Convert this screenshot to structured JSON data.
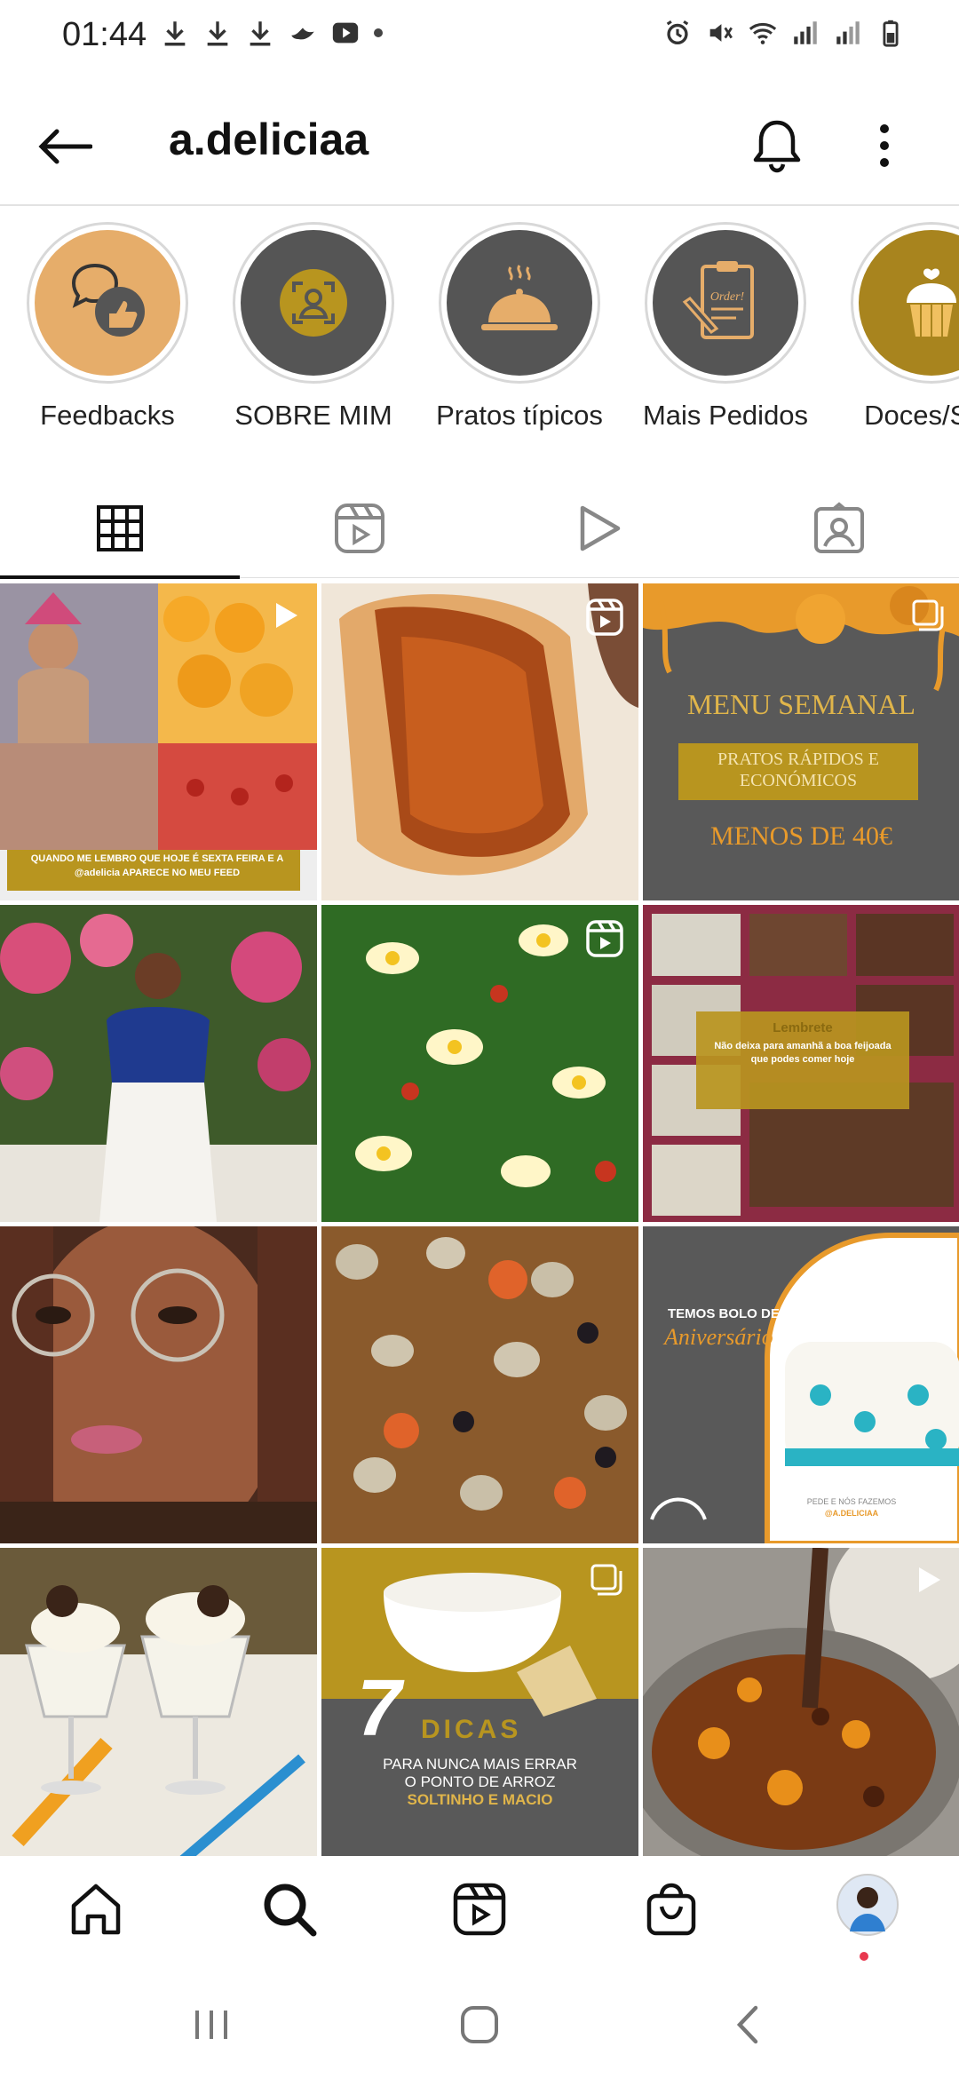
{
  "status_bar": {
    "time": "01:44"
  },
  "header": {
    "username": "a.deliciaa"
  },
  "highlights": [
    {
      "label": "Feedbacks",
      "bg": "#e6ad6a",
      "icon": "feedback-thumb-icon"
    },
    {
      "label": "SOBRE MIM",
      "bg": "#555555",
      "icon": "person-frame-icon"
    },
    {
      "label": "Pratos típicos",
      "bg": "#555555",
      "icon": "cloche-icon"
    },
    {
      "label": "Mais Pedidos",
      "bg": "#555555",
      "icon": "order-clipboard-icon"
    },
    {
      "label": "Doces/Sob",
      "bg": "#a8841e",
      "icon": "cupcake-icon"
    }
  ],
  "tabs": [
    "grid-icon",
    "reels-icon",
    "video-play-icon",
    "tagged-icon"
  ],
  "posts": {
    "p1_caption_line1": "QUANDO ME LEMBRO QUE HOJE É SEXTA FEIRA E A",
    "p1_caption_line2": "@adelicia APARECE NO MEU FEED",
    "p3_title": "MENU SEMANAL",
    "p3_box_line1": "PRATOS RÁPIDOS E",
    "p3_box_line2": "ECONÓMICOS",
    "p3_price": "MENOS DE 40€",
    "p6_title": "Lembrete",
    "p6_line1": "Não deixa para amanhã a boa feijoada",
    "p6_line2": "que podes comer hoje",
    "p9_title": "TEMOS BOLO DE",
    "p9_script": "Aniversário",
    "p9_footer1": "PEDE E NÓS FAZEMOS",
    "p9_footer2": "@A.DELICIAA",
    "p11_number": "7",
    "p11_title": "DICAS",
    "p11_line1": "PARA NUNCA MAIS ERRAR",
    "p11_line2": "O PONTO DE ARROZ",
    "p11_line3": "SOLTINHO E MACIO"
  },
  "colors": {
    "gold": "#b8951f",
    "dark_gray": "#585858",
    "orange": "#e89a2b"
  }
}
